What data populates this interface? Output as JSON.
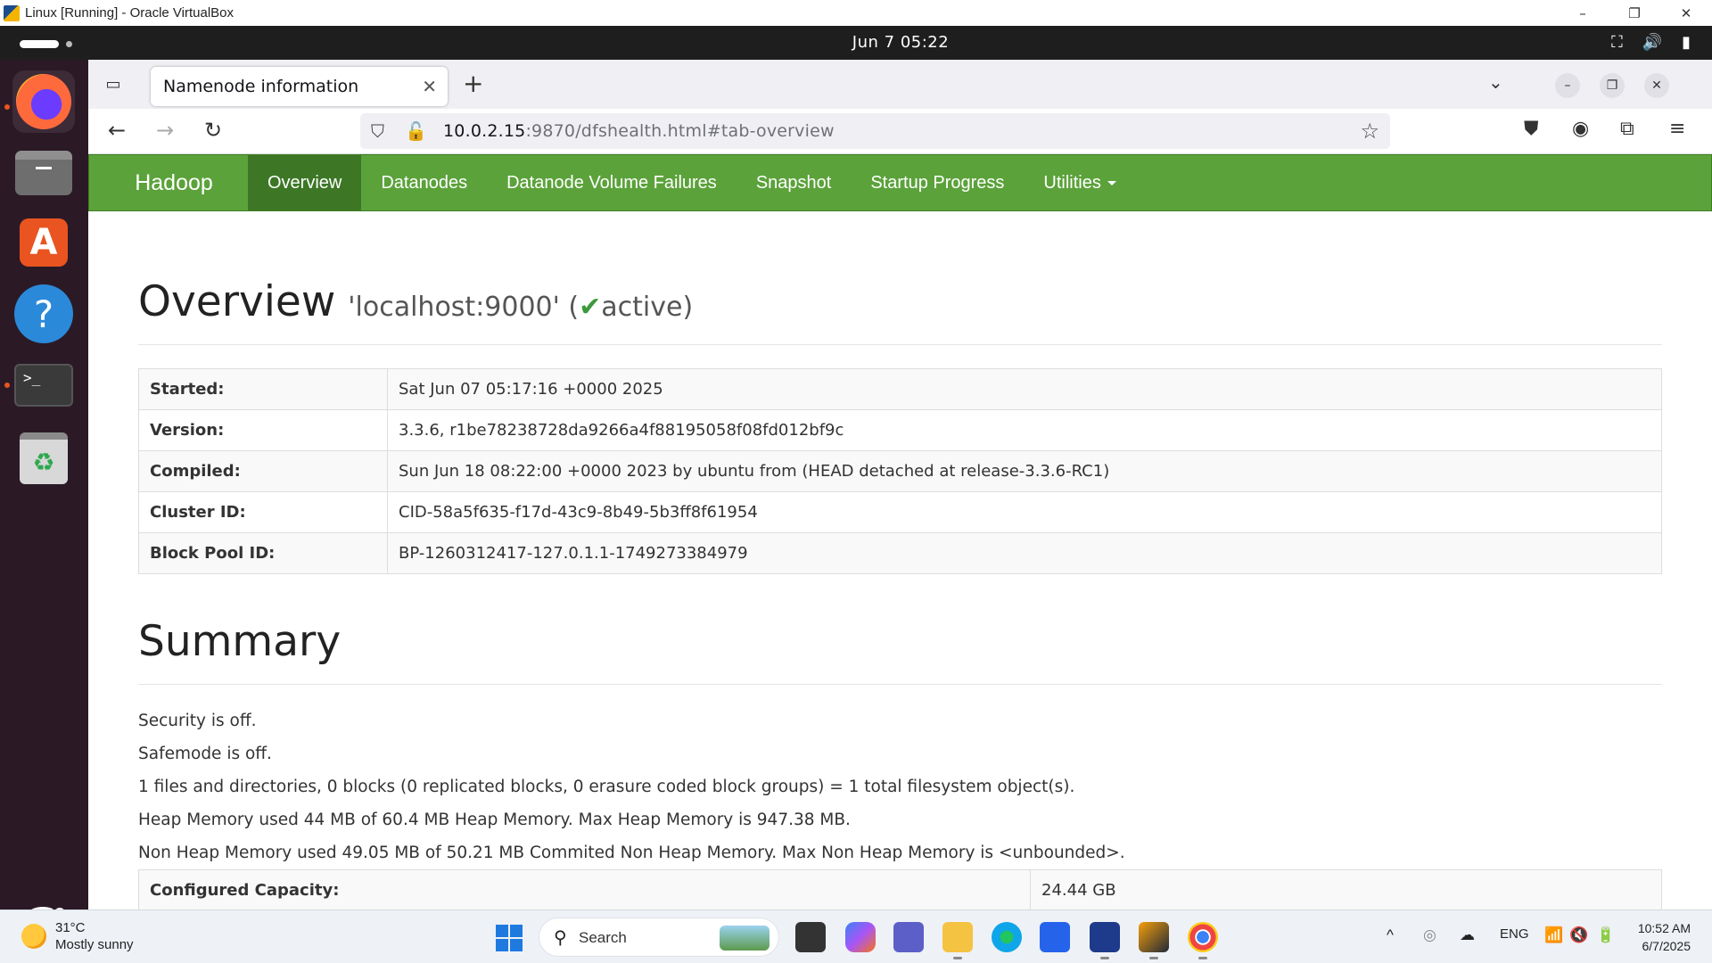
{
  "vbox": {
    "title": "Linux [Running] - Oracle VirtualBox",
    "min": "–",
    "restore": "❐",
    "close": "✕"
  },
  "gnome": {
    "clock": "Jun 7  05:22",
    "net_icon": "⛶",
    "vol_icon": "🔊",
    "bat_icon": "▮"
  },
  "dock": {
    "terminal_glyph": ">_",
    "help_glyph": "?",
    "store_glyph": "A",
    "trash_glyph": "♻"
  },
  "firefox": {
    "tab_title": "Namenode information",
    "tab_close": "✕",
    "new_tab": "+",
    "tabs_dropdown": "⌄",
    "win_min": "–",
    "win_restore": "❐",
    "win_close": "✕",
    "back": "←",
    "forward": "→",
    "reload": "↻",
    "url_host": "10.0.2.15",
    "url_rest": ":9870/dfshealth.html#tab-overview",
    "shield": "⛉",
    "lock": "🔓",
    "star": "☆",
    "pocket": "⛊",
    "account": "◉",
    "extensions": "⧉",
    "menu": "≡"
  },
  "hadoop_nav": {
    "brand": "Hadoop",
    "items": [
      "Overview",
      "Datanodes",
      "Datanode Volume Failures",
      "Snapshot",
      "Startup Progress",
      "Utilities"
    ]
  },
  "overview": {
    "title": "Overview",
    "host": "'localhost:9000' (",
    "check": "✔",
    "state": "active)",
    "rows": [
      {
        "k": "Started:",
        "v": "Sat Jun 07 05:17:16 +0000 2025"
      },
      {
        "k": "Version:",
        "v": "3.3.6, r1be78238728da9266a4f88195058f08fd012bf9c"
      },
      {
        "k": "Compiled:",
        "v": "Sun Jun 18 08:22:00 +0000 2023 by ubuntu from (HEAD detached at release-3.3.6-RC1)"
      },
      {
        "k": "Cluster ID:",
        "v": "CID-58a5f635-f17d-43c9-8b49-5b3ff8f61954"
      },
      {
        "k": "Block Pool ID:",
        "v": "BP-1260312417-127.0.1.1-1749273384979"
      }
    ]
  },
  "summary": {
    "title": "Summary",
    "lines": [
      "Security is off.",
      "Safemode is off.",
      "1 files and directories, 0 blocks (0 replicated blocks, 0 erasure coded block groups) = 1 total filesystem object(s).",
      "Heap Memory used 44 MB of 60.4 MB Heap Memory. Max Heap Memory is 947.38 MB.",
      "Non Heap Memory used 49.05 MB of 50.21 MB Commited Non Heap Memory. Max Non Heap Memory is <unbounded>."
    ],
    "capacity_label": "Configured Capacity:",
    "capacity_value": "24.44 GB"
  },
  "taskbar": {
    "temp": "31°C",
    "condition": "Mostly sunny",
    "search": "Search",
    "search_icon": "⚲",
    "chevron": "^",
    "lang": "ENG",
    "wifi": "📶",
    "sound": "🔇",
    "battery": "🔋",
    "time": "10:52 AM",
    "date": "6/7/2025"
  }
}
